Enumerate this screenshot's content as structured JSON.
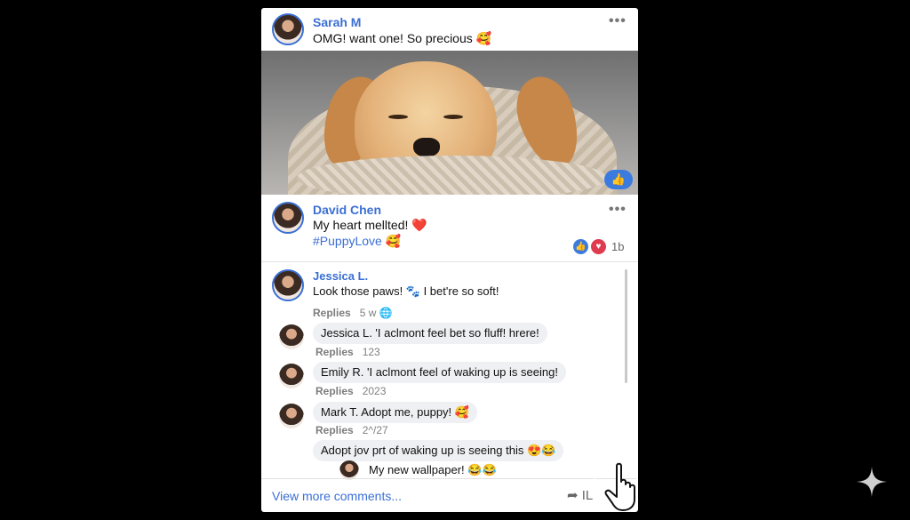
{
  "post": {
    "author": "Sarah M",
    "text": "OMG! want one! So precious 🥰",
    "more": "•••",
    "like_badge": "👍"
  },
  "comment_main": {
    "author": "David Chen",
    "line1": "My heart mellted! ❤️",
    "line2": "#PuppyLove 🥰",
    "more": "•••",
    "reaction_count": "1b"
  },
  "thread": {
    "author": "Jessica L.",
    "text": "Look those paws! 🐾 I bet're so soft!",
    "replies_label": "Replies",
    "time": "5 w",
    "replies": [
      {
        "text": "Jessica L. 'I aclmont feel bet so fluff! hrere!",
        "replies_label": "Replies",
        "meta": "123"
      },
      {
        "text": "Emily R. 'I aclmont feel of waking up is seeing!",
        "replies_label": "Replies",
        "meta": "2023"
      },
      {
        "text": "Mark T. Adopt me, puppy! 🥰",
        "replies_label": "Replies",
        "meta": "2^/27"
      }
    ],
    "extra_bubble": "Adopt jov prt of waking up is seeing this 😍😂",
    "last_reply": "My new wallpaper! 😂😂"
  },
  "footer": {
    "view_more": "View more comments...",
    "share_glyph": "➦",
    "share_label": "IL"
  },
  "colors": {
    "accent": "#3b6fd4",
    "like": "#3b7be0",
    "love": "#e03a4e"
  }
}
